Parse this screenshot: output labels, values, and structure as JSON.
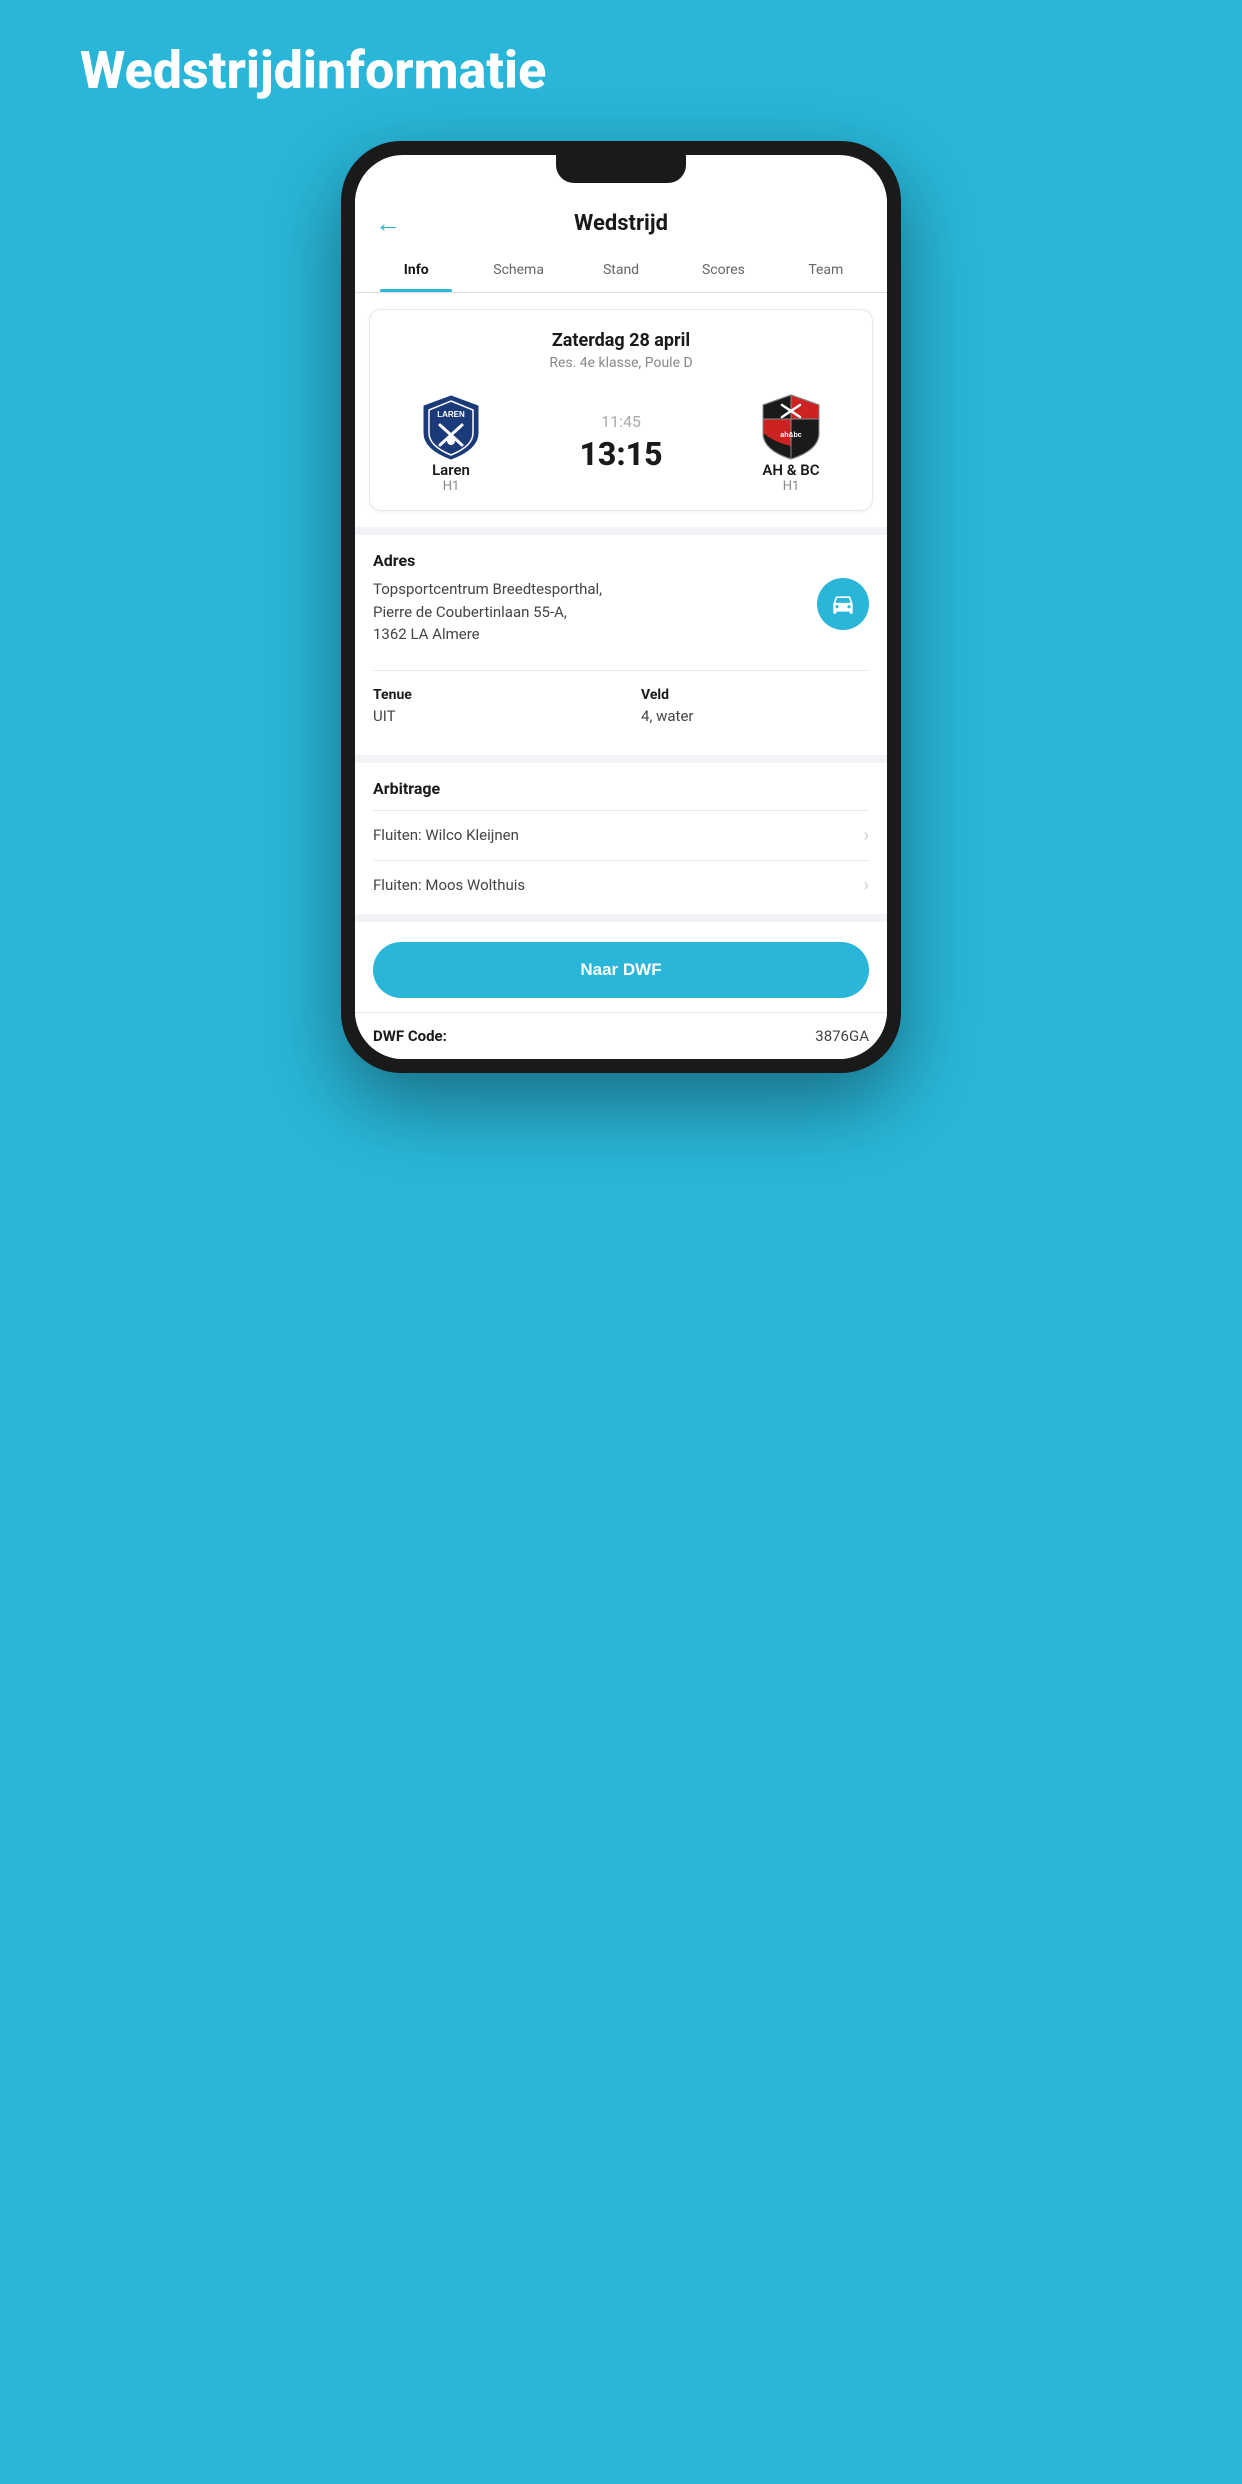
{
  "page": {
    "title": "Wedstrijdinformatie"
  },
  "header": {
    "back_icon": "←",
    "title": "Wedstrijd"
  },
  "tabs": [
    {
      "label": "Info",
      "active": true
    },
    {
      "label": "Schema",
      "active": false
    },
    {
      "label": "Stand",
      "active": false
    },
    {
      "label": "Scores",
      "active": false
    },
    {
      "label": "Team",
      "active": false
    }
  ],
  "match": {
    "date": "Zaterdag 28 april",
    "league": "Res. 4e klasse, Poule D",
    "home_team": "Laren",
    "home_sub": "H1",
    "away_team": "AH & BC",
    "away_sub": "H1",
    "time": "11:45",
    "score": "13:15"
  },
  "address": {
    "label": "Adres",
    "value": "Topsportcentrum Breedtesporthal,\nPierre de Coubertinlaan 55-A,\n1362 LA Almere"
  },
  "tenue": {
    "label": "Tenue",
    "value": "UIT"
  },
  "veld": {
    "label": "Veld",
    "value": "4, water"
  },
  "arbitrage": {
    "label": "Arbitrage",
    "referee1": "Fluiten: Wilco Kleijnen",
    "referee2": "Fluiten: Moos Wolthuis"
  },
  "dwf": {
    "button_label": "Naar DWF",
    "code_label": "DWF Code:",
    "code_value": "3876GA"
  }
}
